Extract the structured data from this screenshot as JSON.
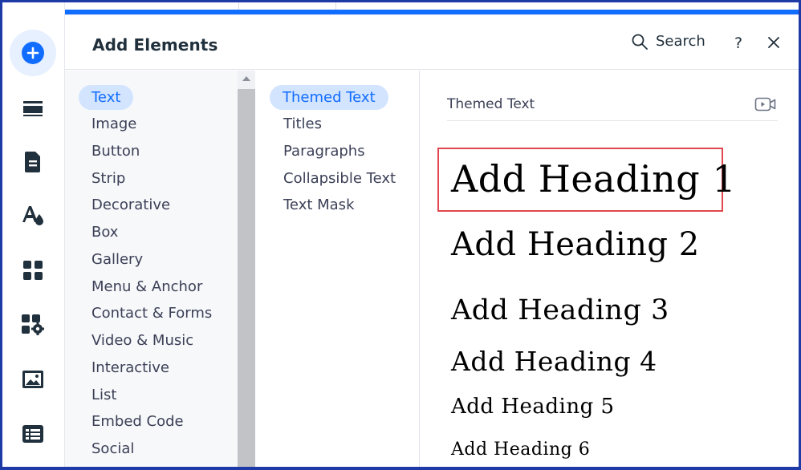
{
  "panel": {
    "title": "Add Elements",
    "search_label": "Search",
    "help_label": "?"
  },
  "categories": [
    {
      "label": "Text",
      "active": true
    },
    {
      "label": "Image"
    },
    {
      "label": "Button"
    },
    {
      "label": "Strip"
    },
    {
      "label": "Decorative"
    },
    {
      "label": "Box"
    },
    {
      "label": "Gallery"
    },
    {
      "label": "Menu & Anchor"
    },
    {
      "label": "Contact & Forms"
    },
    {
      "label": "Video & Music"
    },
    {
      "label": "Interactive"
    },
    {
      "label": "List"
    },
    {
      "label": "Embed Code"
    },
    {
      "label": "Social"
    }
  ],
  "subcategories": [
    {
      "label": "Themed Text",
      "active": true
    },
    {
      "label": "Titles"
    },
    {
      "label": "Paragraphs"
    },
    {
      "label": "Collapsible Text"
    },
    {
      "label": "Text Mask"
    }
  ],
  "preview": {
    "section_title": "Themed Text",
    "headings": [
      {
        "label": "Add Heading 1"
      },
      {
        "label": "Add Heading 2"
      },
      {
        "label": "Add Heading 3"
      },
      {
        "label": "Add Heading 4"
      },
      {
        "label": "Add Heading 5"
      },
      {
        "label": "Add Heading 6"
      }
    ]
  },
  "rail_icons": [
    "add-elements-icon",
    "sections-icon",
    "pages-icon",
    "site-design-icon",
    "apps-icon",
    "business-tools-icon",
    "media-icon",
    "cms-icon"
  ],
  "colors": {
    "accent": "#116dff",
    "active_bg": "#d3e4ff",
    "highlight_border": "#e0474f",
    "frame_border": "#1d3aa6"
  }
}
